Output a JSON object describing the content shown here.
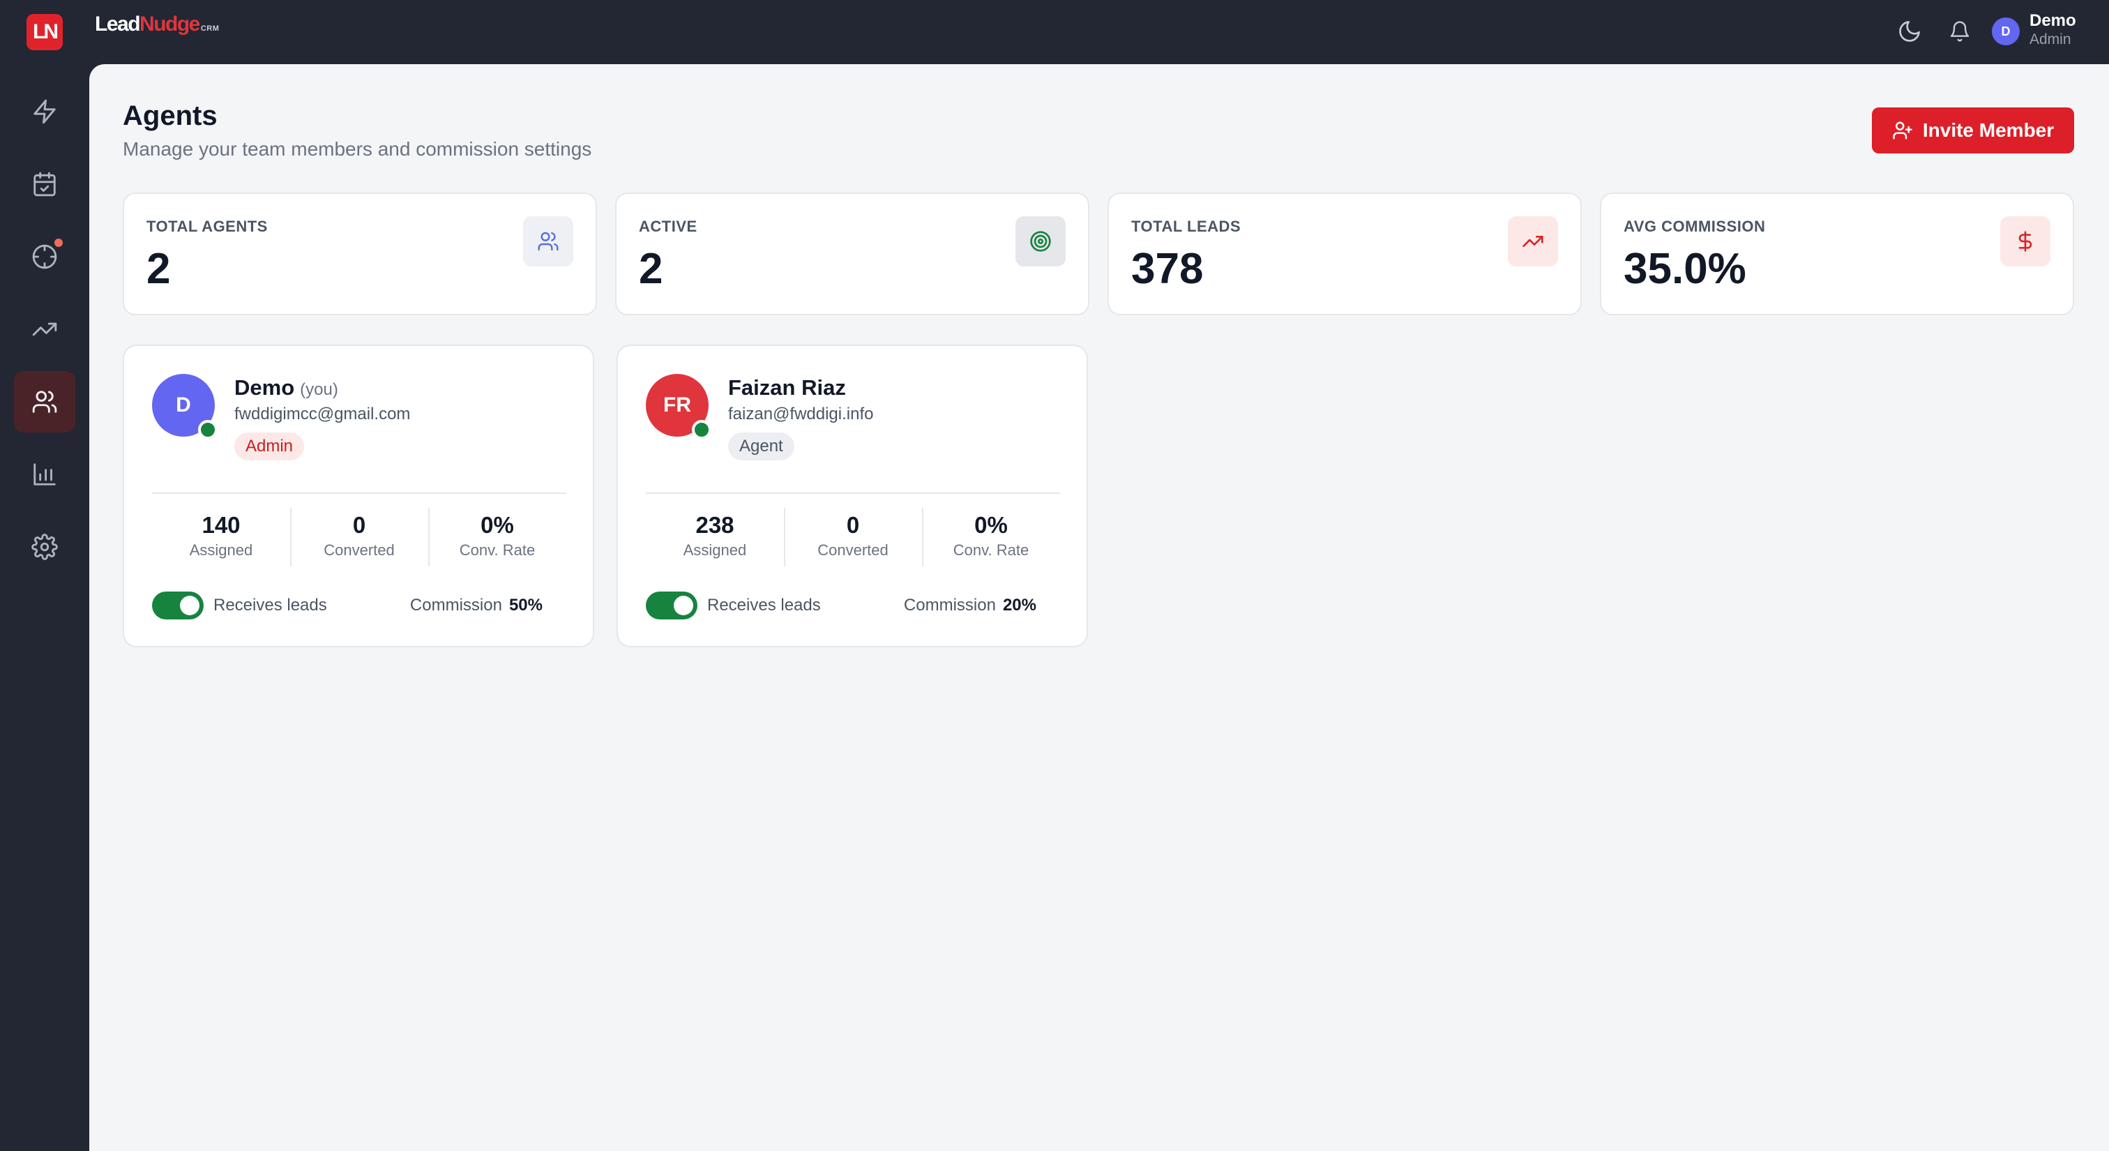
{
  "app": {
    "icon_text": "LN",
    "brand_lead": "Lead",
    "brand_nudge": "Nudge",
    "brand_crm": "CRM"
  },
  "topbar": {
    "icons": [
      "moon-icon",
      "bell-icon"
    ],
    "user": {
      "initial": "D",
      "name": "Demo",
      "role": "Admin"
    }
  },
  "sidebar": {
    "items": [
      {
        "icon": "lightning-icon",
        "active": false
      },
      {
        "icon": "calendar-check-icon",
        "active": false
      },
      {
        "icon": "crosshair-icon",
        "active": false,
        "has_notification": true
      },
      {
        "icon": "trending-up-icon",
        "active": false
      },
      {
        "icon": "users-icon",
        "active": true
      },
      {
        "icon": "bar-chart-icon",
        "active": false
      },
      {
        "icon": "settings-icon",
        "active": false
      }
    ]
  },
  "page": {
    "title": "Agents",
    "subtitle": "Manage your team members and commission settings",
    "invite_button": "Invite Member"
  },
  "stats": [
    {
      "label": "TOTAL AGENTS",
      "value": "2",
      "icon": "users-icon",
      "icon_color": "#5b6cd6"
    },
    {
      "label": "ACTIVE",
      "value": "2",
      "icon": "target-icon",
      "icon_color": "#16833f"
    },
    {
      "label": "TOTAL LEADS",
      "value": "378",
      "icon": "trending-up-icon",
      "icon_color": "#dc2626"
    },
    {
      "label": "AVG COMMISSION",
      "value": "35.0%",
      "icon": "dollar-icon",
      "icon_color": "#dc2626"
    }
  ],
  "agents": [
    {
      "initials": "D",
      "avatar_color": "#6366f1",
      "name": "Demo",
      "you_label": "(you)",
      "email": "fwddigimcc@gmail.com",
      "role": "Admin",
      "online": true,
      "metrics": [
        {
          "value": "140",
          "label": "Assigned"
        },
        {
          "value": "0",
          "label": "Converted"
        },
        {
          "value": "0%",
          "label": "Conv. Rate"
        }
      ],
      "receives_leads_label": "Receives leads",
      "receives_leads": true,
      "commission_label": "Commission",
      "commission_value": "50%"
    },
    {
      "initials": "FR",
      "avatar_color": "#e0353d",
      "name": "Faizan Riaz",
      "you_label": "",
      "email": "faizan@fwddigi.info",
      "role": "Agent",
      "online": true,
      "metrics": [
        {
          "value": "238",
          "label": "Assigned"
        },
        {
          "value": "0",
          "label": "Converted"
        },
        {
          "value": "0%",
          "label": "Conv. Rate"
        }
      ],
      "receives_leads_label": "Receives leads",
      "receives_leads": true,
      "commission_label": "Commission",
      "commission_value": "20%"
    }
  ],
  "colors": {
    "accent": "#dc1f28",
    "online": "#16833f",
    "sidebar_bg": "#222733",
    "main_bg": "#f4f5f7"
  }
}
